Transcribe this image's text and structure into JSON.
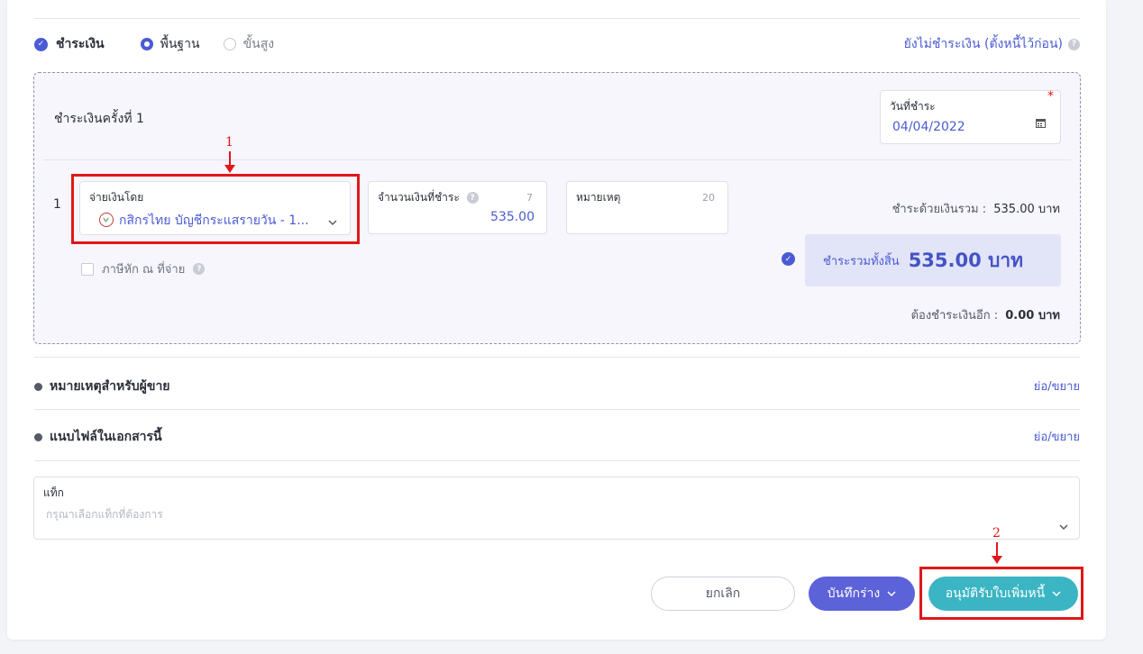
{
  "payment": {
    "title": "ชำระเงิน",
    "mode_basic": "พื้นฐาน",
    "mode_advanced": "ขั้นสูง",
    "unpaid_link": "ยังไม่ชำระเงิน (ตั้งหนี้ไว้ก่อน)",
    "round_title": "ชำระเงินครั้งที่ 1",
    "date_label": "วันที่ชำระ",
    "date_value": "04/04/2022",
    "line_no": "1",
    "paid_by_label": "จ่ายเงินโดย",
    "paid_by_value": "กสิกรไทย บัญชีกระแสรายวัน - 1...",
    "amount_label": "จำนวนเงินที่ชำระ",
    "amount_counter": "7",
    "amount_value": "535.00",
    "note_label": "หมายเหตุ",
    "note_counter": "20",
    "withholding_label": "ภาษีหัก ณ ที่จ่าย",
    "total_cash_label": "ชำระด้วยเงินรวม :",
    "total_cash_value": "535.00 บาท",
    "grand_total_label": "ชำระรวมทั้งสิ้น",
    "grand_total_value": "535.00 บาท",
    "remaining_label": "ต้องชำระเงินอีก :",
    "remaining_value": "0.00 บาท"
  },
  "sections": {
    "seller_note": "หมายเหตุสำหรับผู้ขาย",
    "attachments": "แนบไฟล์ในเอกสารนี้",
    "toggle": "ย่อ/ขยาย"
  },
  "tag": {
    "label": "แท็ก",
    "placeholder": "กรุณาเลือกแท็กที่ต้องการ"
  },
  "footer": {
    "cancel": "ยกเลิก",
    "save_draft": "บันทึกร่าง",
    "approve": "อนุมัติรับใบเพิ่มหนี้"
  },
  "annotations": {
    "marker_1": "1",
    "marker_2": "2"
  },
  "colors": {
    "accent": "#4a5bd4",
    "approve": "#3bb5c4",
    "annotation": "#e01818"
  }
}
